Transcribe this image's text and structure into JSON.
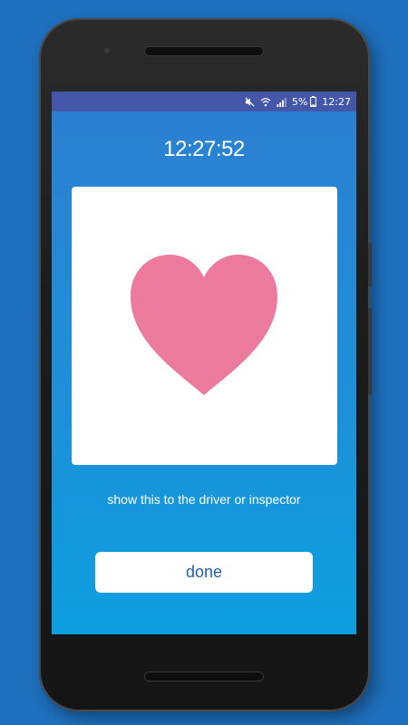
{
  "status_bar": {
    "battery_percent": "5%",
    "time": "12:27",
    "icons": [
      "mute-icon",
      "wifi-icon",
      "signal-icon",
      "battery-icon"
    ]
  },
  "ticket": {
    "clock": "12:27:52",
    "symbol": "heart-icon",
    "symbol_color": "#ec7a9c",
    "instruction": "show this to the driver or inspector"
  },
  "actions": {
    "done_label": "done"
  },
  "colors": {
    "background": "#1e6fbd",
    "status_bar": "#4356a8",
    "screen_top": "#2c7fd0",
    "screen_bottom": "#0d9ee0",
    "button_text": "#1f5ea8"
  }
}
